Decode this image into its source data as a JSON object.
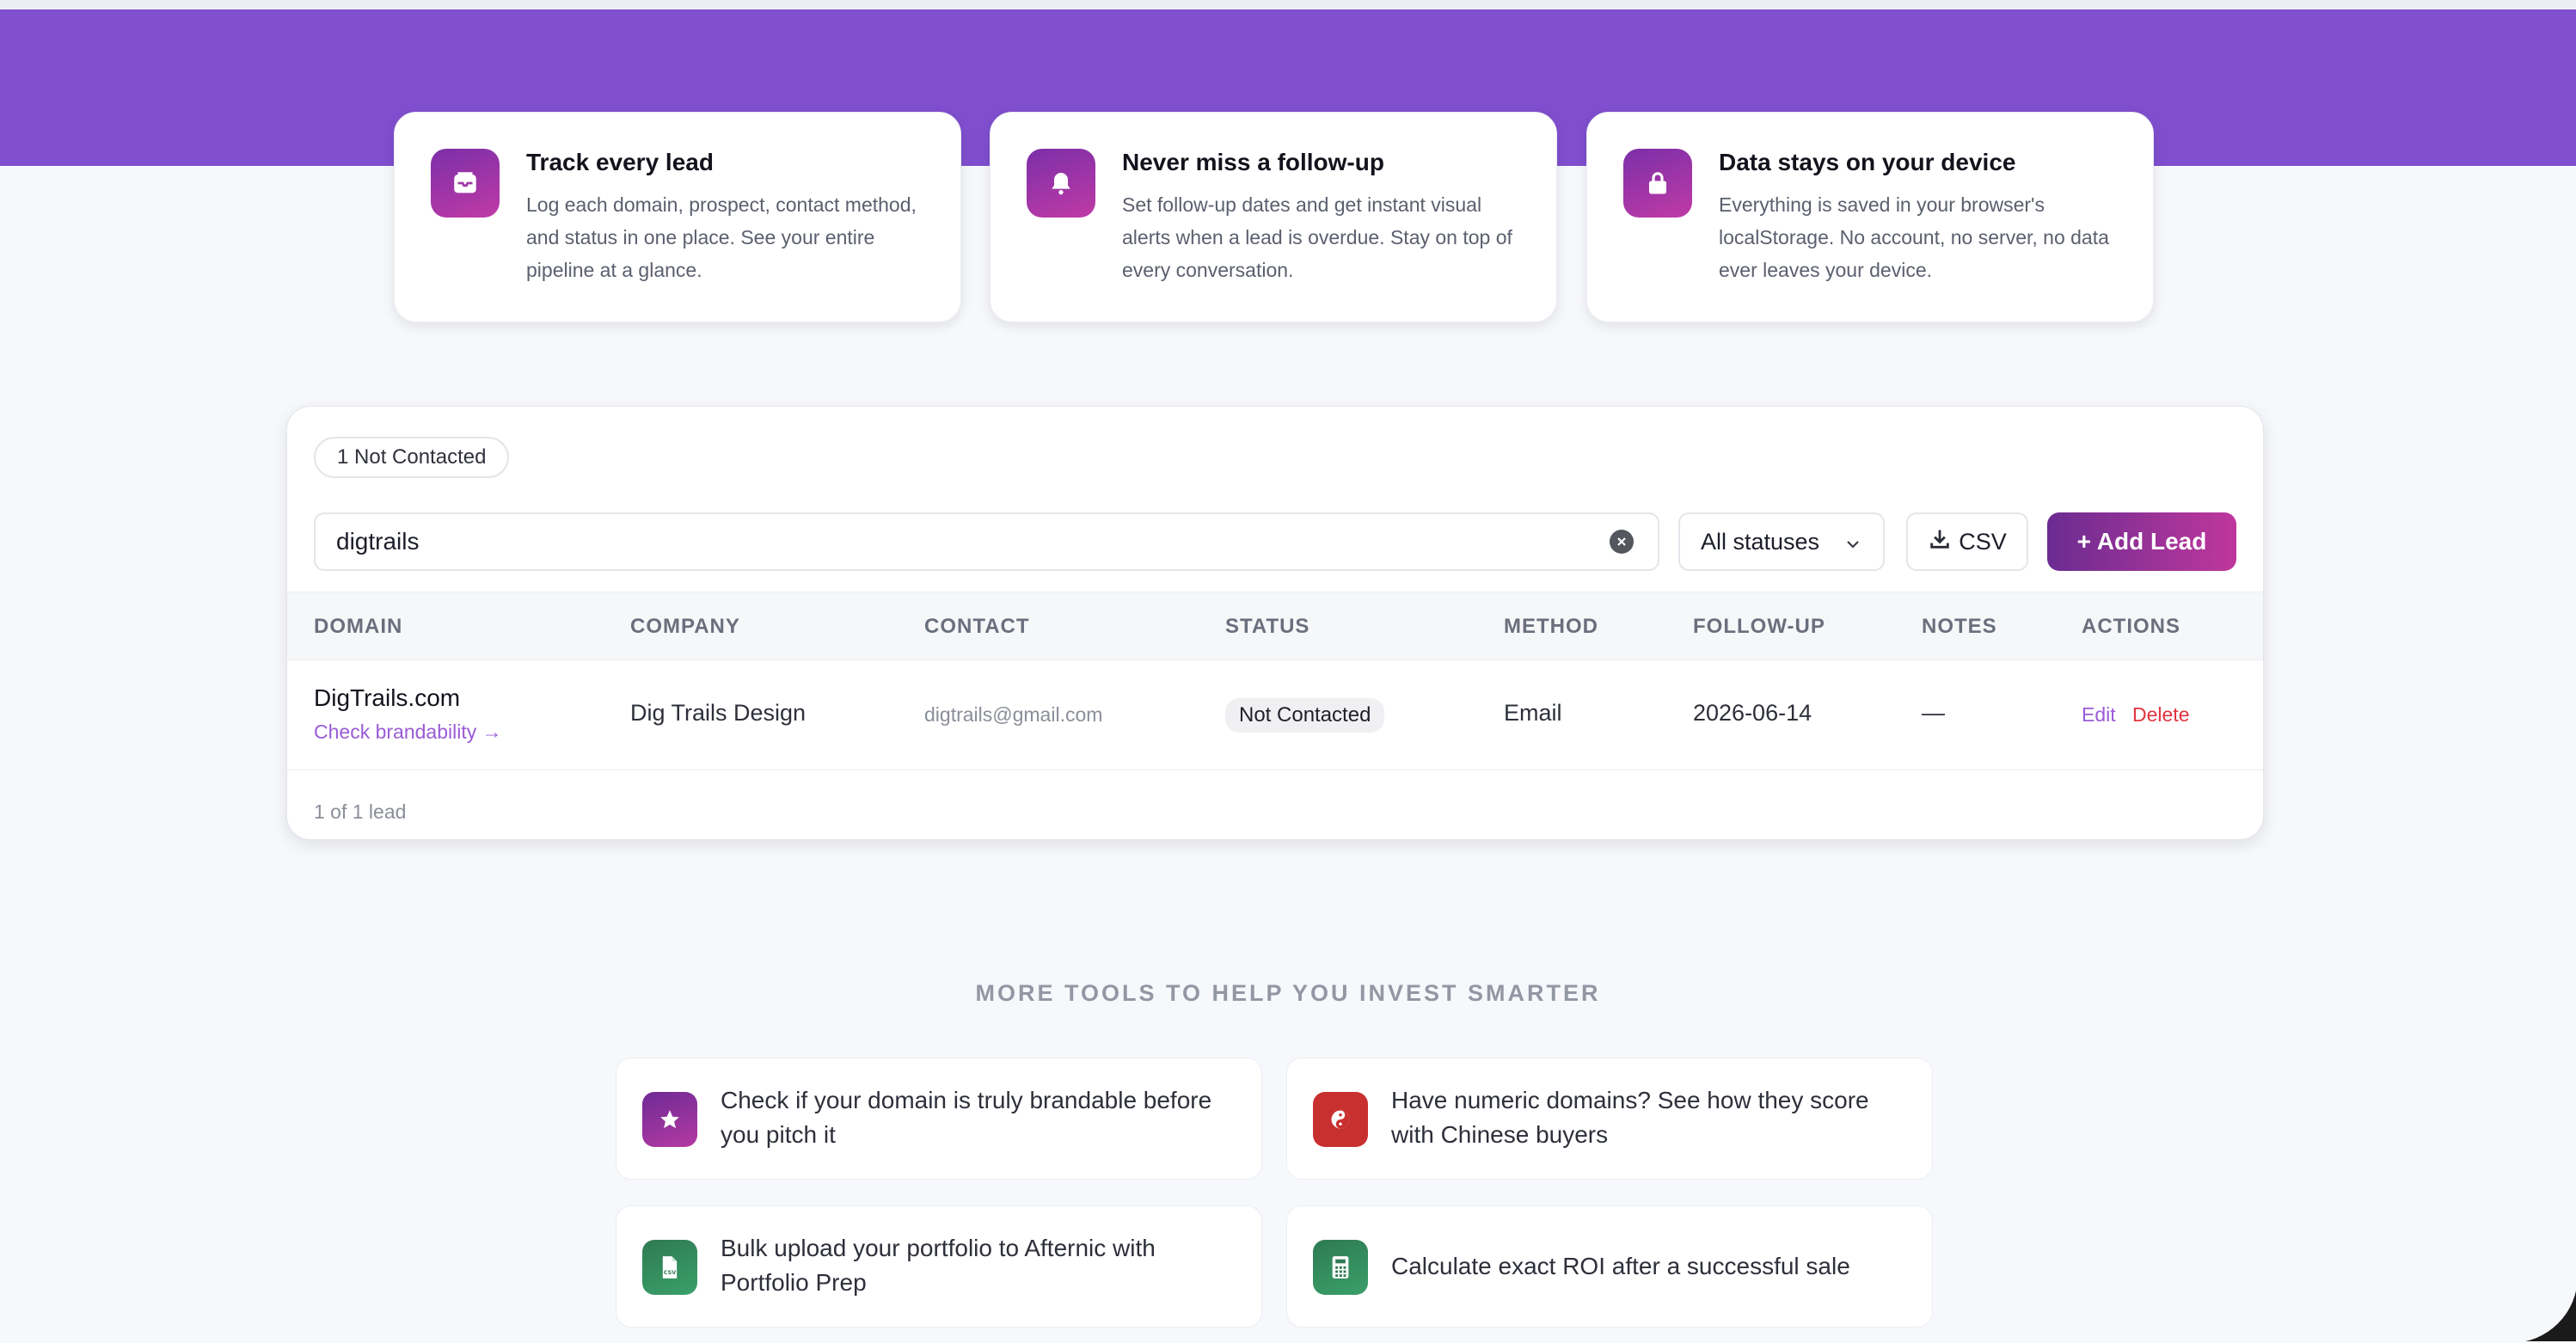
{
  "features": [
    {
      "icon": "inbox-icon",
      "title": "Track every lead",
      "desc": "Log each domain, prospect, contact method, and status in one place. See your entire pipeline at a glance."
    },
    {
      "icon": "bell-icon",
      "title": "Never miss a follow-up",
      "desc": "Set follow-up dates and get instant visual alerts when a lead is overdue. Stay on top of every conversation."
    },
    {
      "icon": "lock-icon",
      "title": "Data stays on your device",
      "desc": "Everything is saved in your browser's localStorage. No account, no server, no data ever leaves your device."
    }
  ],
  "leads": {
    "summary_pill": "1 Not Contacted",
    "search_value": "digtrails",
    "status_filter": "All statuses",
    "csv_label": "CSV",
    "add_label": "+ Add Lead",
    "columns": [
      "DOMAIN",
      "COMPANY",
      "CONTACT",
      "STATUS",
      "METHOD",
      "FOLLOW-UP",
      "NOTES",
      "ACTIONS"
    ],
    "rows": [
      {
        "domain": "DigTrails.com",
        "brand_link": "Check brandability →",
        "company": "Dig Trails Design",
        "contact": "digtrails@gmail.com",
        "status": "Not Contacted",
        "method": "Email",
        "followup": "2026-06-14",
        "notes": "—",
        "edit": "Edit",
        "delete": "Delete"
      }
    ],
    "footer": "1 of 1 lead"
  },
  "more_tools": {
    "title": "MORE TOOLS TO HELP YOU INVEST SMARTER",
    "items": [
      {
        "icon": "star-icon",
        "text": "Check if your domain is truly brandable before you pitch it",
        "color": "#8a2fa3"
      },
      {
        "icon": "yin-yang-icon",
        "text": "Have numeric domains? See how they score with Chinese buyers",
        "color": "#c8302f"
      },
      {
        "icon": "csv-file-icon",
        "text": "Bulk upload your portfolio to Afternic with Portfolio Prep",
        "color": "#2e8b57"
      },
      {
        "icon": "calculator-icon",
        "text": "Calculate exact ROI after a successful sale",
        "color": "#2e8b57"
      }
    ]
  },
  "colors": {
    "banner": "#804fcf",
    "accent": "#9a5bd6",
    "danger": "#e0343f"
  }
}
